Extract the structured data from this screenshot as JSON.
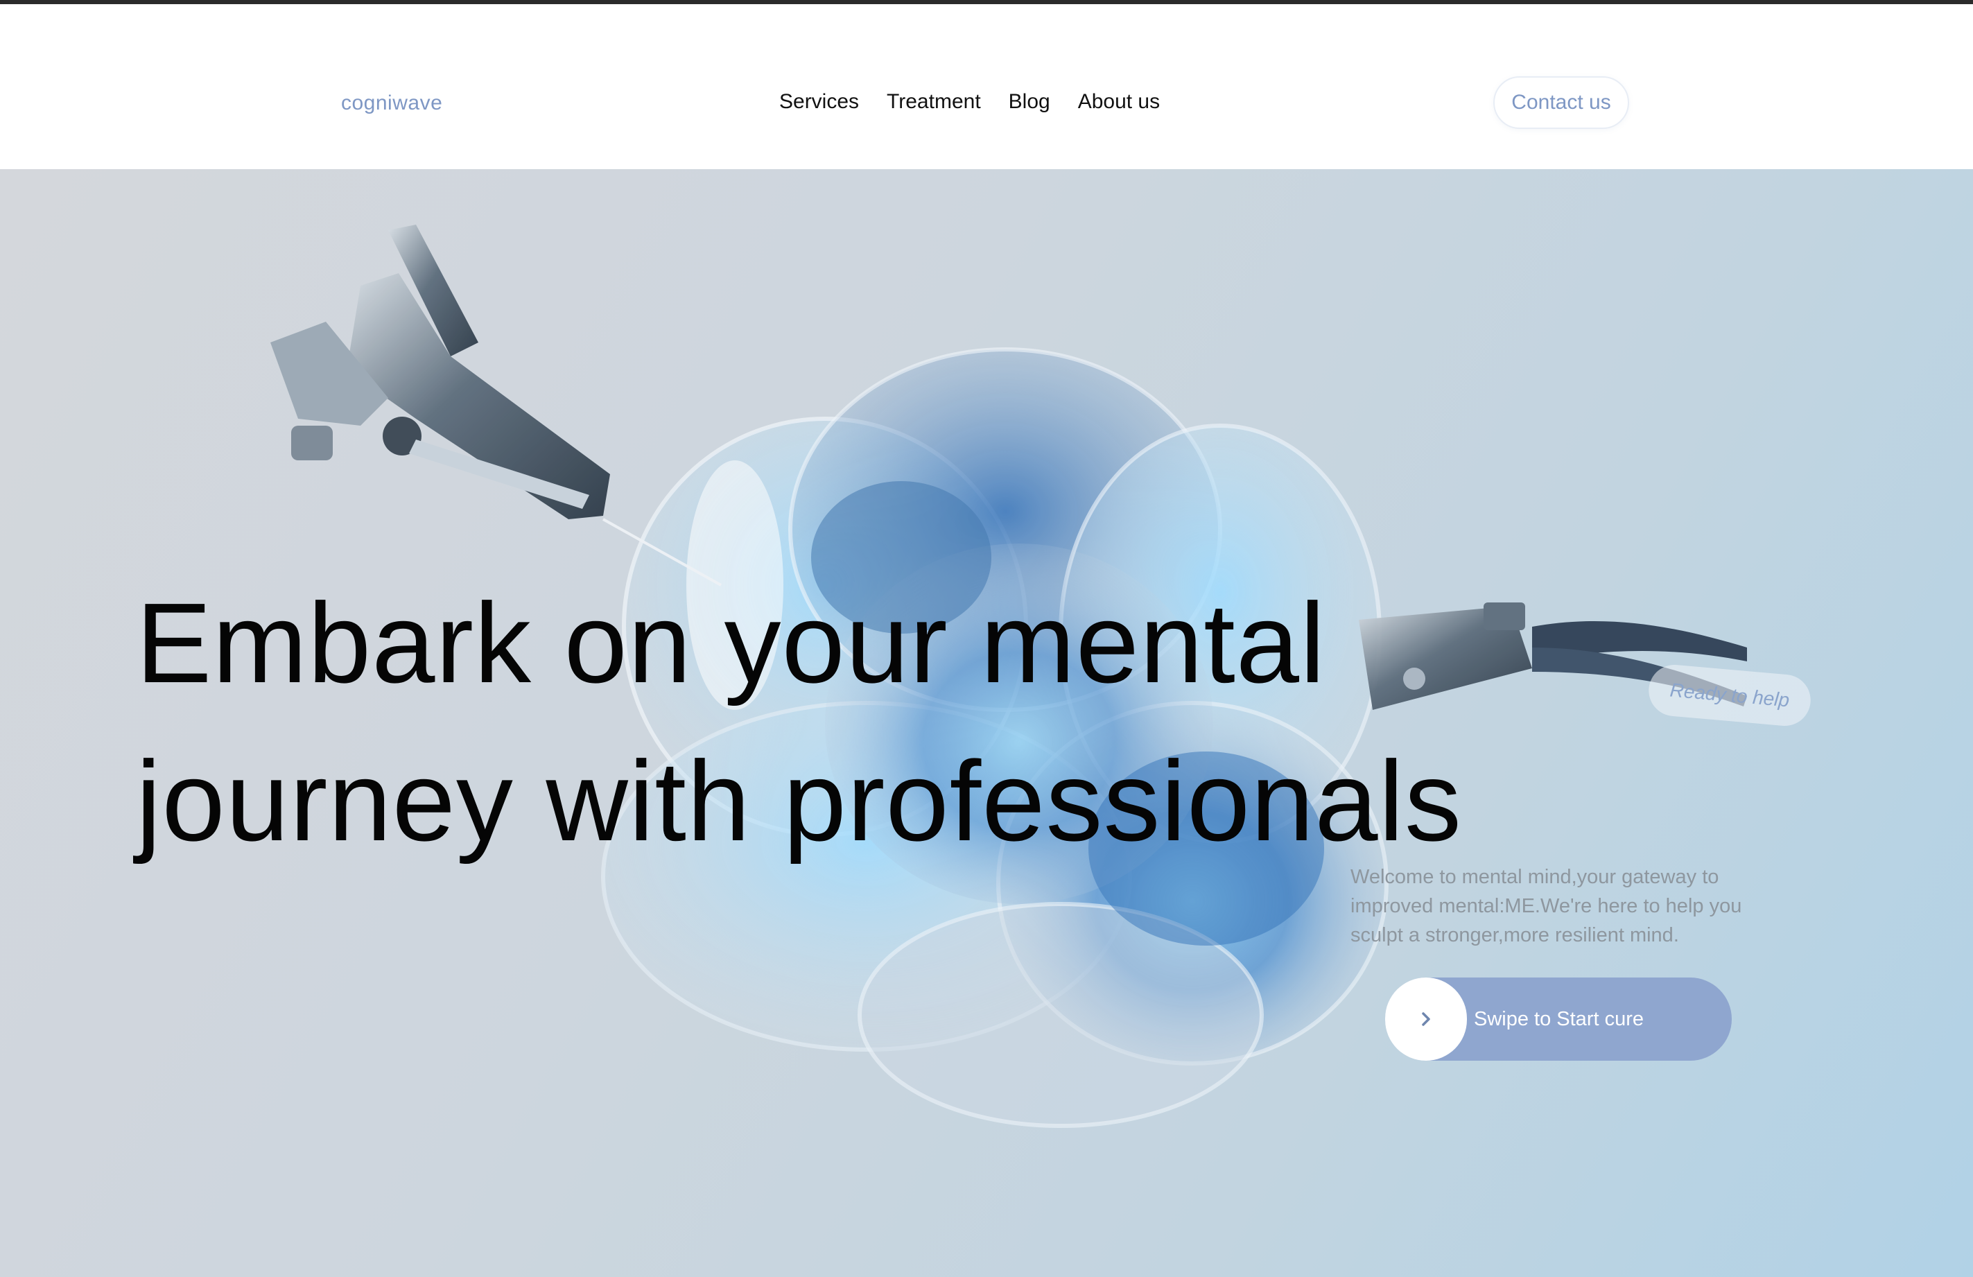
{
  "header": {
    "logo": "cogniwave",
    "nav": [
      "Services",
      "Treatment",
      "Blog",
      "About us"
    ],
    "contact_label": "Contact us"
  },
  "hero": {
    "headline_line1": "Embark on your mental",
    "headline_line2": "journey with professionals",
    "ready_label": "Ready to help",
    "welcome_text": "Welcome to mental mind,your gateway to improved mental:ME.We're here to help you sculpt a stronger,more resilient mind.",
    "swipe_label": "Swipe to Start cure",
    "swipe_icon": "chevron-right-icon"
  },
  "colors": {
    "accent": "#8fa6cf",
    "logo": "#7e97c4",
    "text": "#050505",
    "muted": "#8e979f"
  }
}
